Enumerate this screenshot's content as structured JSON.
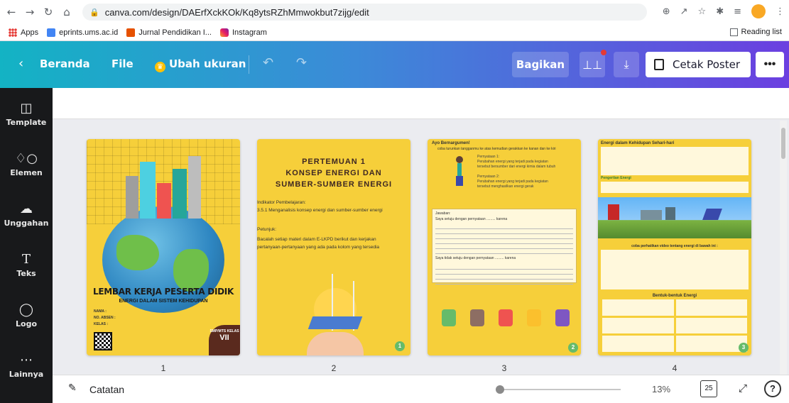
{
  "browser": {
    "url": "canva.com/design/DAErfXckKOk/Kq8ytsRZhMmwokbut7zijg/edit",
    "bookmarks": [
      "Apps",
      "eprints.ums.ac.id",
      "Jurnal Pendidikan I...",
      "Instagram"
    ],
    "reading_list": "Reading list"
  },
  "header": {
    "home": "Beranda",
    "file": "File",
    "resize": "Ubah ukuran",
    "share": "Bagikan",
    "print": "Cetak Poster",
    "more": "•••"
  },
  "sidebar": [
    {
      "label": "Template",
      "icon": "template-icon"
    },
    {
      "label": "Elemen",
      "icon": "elements-icon"
    },
    {
      "label": "Unggahan",
      "icon": "upload-icon"
    },
    {
      "label": "Teks",
      "icon": "text-icon"
    },
    {
      "label": "Logo",
      "icon": "logo-icon"
    },
    {
      "label": "Lainnya",
      "icon": "more-icon"
    }
  ],
  "pages": {
    "numbers": [
      "1",
      "2",
      "3",
      "4"
    ],
    "p1": {
      "title": "LEMBAR KERJA PESERTA DIDIK",
      "subtitle": "ENERGI DALAM SISTEM KEHIDUPAN",
      "fields": [
        "NAMA      :",
        "NO. ABSEN :",
        "KELAS     :"
      ],
      "school": "SMP/MTS KELAS",
      "grade": "VII"
    },
    "p2": {
      "title1": "PERTEMUAN 1",
      "title2": "KONSEP ENERGI DAN",
      "title3": "SUMBER-SUMBER ENERGI",
      "ind_head": "Indikator Pembelajaran:",
      "ind_body": "3.5.1 Menganalisis konsep energi dan sumber-sumber energi",
      "pet_head": "Petunjuk:",
      "pet_body": "Bacalah setiap materi dalam E-LKPD berikut dan kerjakan pertanyaan-pertanyaan yang ada pada kolom yang tersedia",
      "badge": "1"
    },
    "p3": {
      "heading": "Ayo Bernargumen!",
      "intro": "coba turunkan tangganmu ke atas kemudian gerakkan ke kanan dan ke kiri",
      "jawaban": "Jawaban:",
      "line1": "Saya setuju dengan pernyataan ......... karena",
      "line2": "Saya tidak setuju dengan pernyataan ......... karena",
      "badge": "2"
    },
    "p4": {
      "heading": "Energi dalam Kehidupan Sehari-hari",
      "def_head": "Pengertian Energi",
      "video": "coba perhatikan video tentang energi di bawah ini :",
      "forms": "Bentuk-bentuk Energi",
      "badge": "3"
    }
  },
  "bottom": {
    "notes": "Catatan",
    "zoom": "13%",
    "page_count": "25",
    "help": "?"
  },
  "colors": {
    "page_yellow": "#f6cf3a",
    "header_start": "#13b3c4",
    "header_end": "#6b3fe0",
    "sidebar": "#18191b"
  }
}
